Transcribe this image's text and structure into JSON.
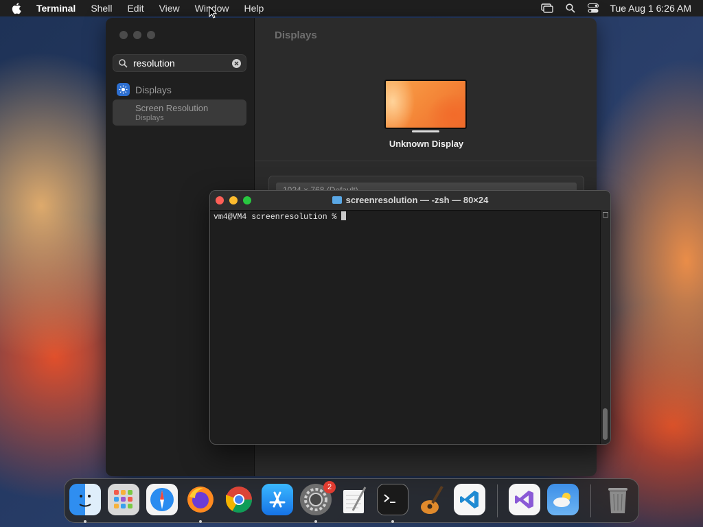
{
  "menubar": {
    "app_name": "Terminal",
    "items": [
      "Shell",
      "Edit",
      "View",
      "Window",
      "Help"
    ],
    "clock": "Tue Aug 1  6:26 AM"
  },
  "settings": {
    "search_value": "resolution",
    "sidebar_item": "Displays",
    "result_title": "Screen Resolution",
    "result_subtitle": "Displays",
    "pane_title": "Displays",
    "display_name": "Unknown Display",
    "resolution_row": "1024 × 768 (Default)"
  },
  "terminal": {
    "title": "screenresolution — -zsh — 80×24",
    "prompt": "vm4@VM4 screenresolution % "
  },
  "dock": {
    "apps": [
      "finder-icon",
      "launchpad-icon",
      "safari-icon",
      "firefox-icon",
      "chrome-icon",
      "app-store-icon",
      "system-settings-icon",
      "textedit-icon",
      "terminal-icon",
      "garageband-icon",
      "vscode-icon",
      "visual-studio-icon",
      "weather-icon",
      "trash-icon"
    ],
    "settings_badge": "2"
  }
}
